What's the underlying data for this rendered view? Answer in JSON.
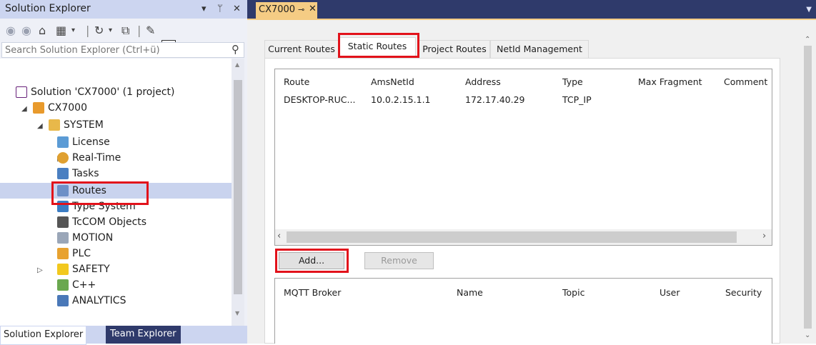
{
  "solution_explorer": {
    "title": "Solution Explorer",
    "title_controls": [
      "▾",
      "ᛘ",
      "✕"
    ],
    "search_placeholder": "Search Solution Explorer (Ctrl+ü)",
    "tree": {
      "solution": "Solution 'CX7000' (1 project)",
      "project": "CX7000",
      "system": "SYSTEM",
      "license": "License",
      "realtime": "Real-Time",
      "tasks": "Tasks",
      "routes": "Routes",
      "type_system": "Type System",
      "tcom": "TcCOM Objects",
      "motion": "MOTION",
      "plc": "PLC",
      "safety": "SAFETY",
      "cpp": "C++",
      "analytics": "ANALYTICS"
    },
    "bottom_tabs": [
      "Solution Explorer",
      "Team Explorer"
    ]
  },
  "document": {
    "tab_title": "CX7000",
    "tab_pin": "⊸",
    "tab_close": "✕",
    "tabs": [
      "Current Routes",
      "Static Routes",
      "Project Routes",
      "NetId Management"
    ],
    "routes_table": {
      "columns": [
        "Route",
        "AmsNetId",
        "Address",
        "Type",
        "Max Fragment",
        "Comment"
      ],
      "rows": [
        [
          "DESKTOP-RUC...",
          "10.0.2.15.1.1",
          "172.17.40.29",
          "TCP_IP",
          "",
          ""
        ]
      ]
    },
    "buttons": {
      "add": "Add...",
      "remove": "Remove"
    },
    "mqtt_table": {
      "columns": [
        "MQTT Broker",
        "Name",
        "Topic",
        "User",
        "Security"
      ]
    }
  },
  "colors": {
    "highlight": "#e2121b",
    "tab_accent": "#f5cc84",
    "title_bar": "#2f3a6b"
  }
}
